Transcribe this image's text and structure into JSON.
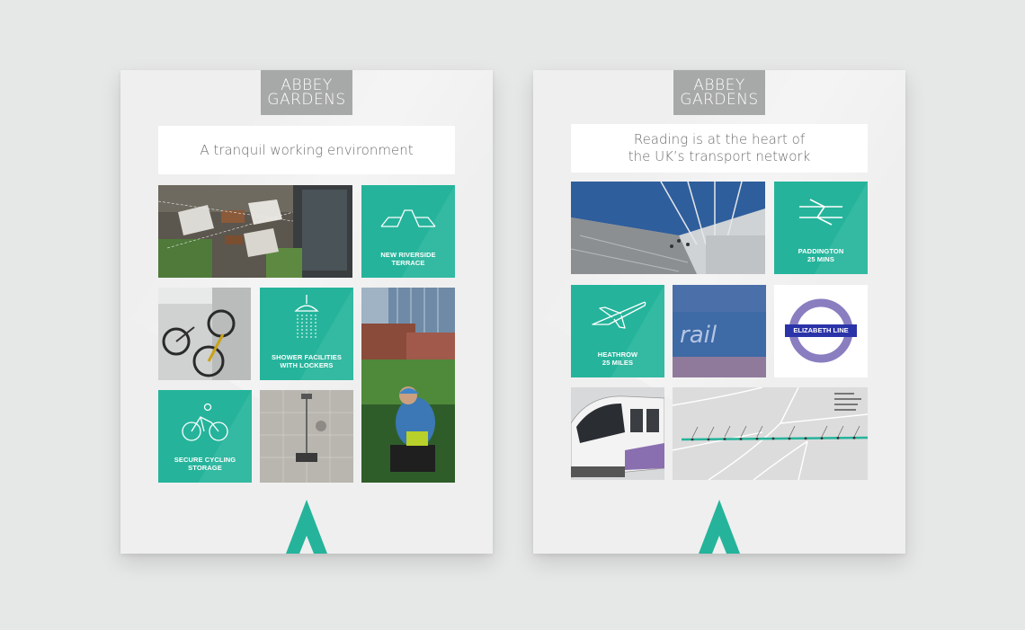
{
  "colors": {
    "background": "#e6e7e7",
    "sheet": "#efefef",
    "teal": "#25b49b",
    "logo_bg": "#a7a8a8",
    "elizabeth_purple": "#8a7ec1",
    "elizabeth_blue": "#2a33a8"
  },
  "sheet1": {
    "logo": {
      "line1": "ABBEY",
      "line2": "GARDENS"
    },
    "title": "A tranquil working environment",
    "tiles": [
      {
        "icon": "terrace-icon",
        "label": "NEW RIVERSIDE\nTERRACE"
      },
      {
        "icon": "shower-icon",
        "label": "SHOWER FACILITIES\nWITH LOCKERS"
      },
      {
        "icon": "cyclist-icon",
        "label": "SECURE CYCLING\nSTORAGE"
      }
    ]
  },
  "sheet2": {
    "logo": {
      "line1": "ABBEY",
      "line2": "GARDENS"
    },
    "title": "Reading is at the heart of\nthe UK’s transport network",
    "tiles": [
      {
        "icon": "national-rail-icon",
        "label": "PADDINGTON\n25 MINS"
      },
      {
        "icon": "airplane-icon",
        "label": "HEATHROW\n25 MILES"
      }
    ],
    "elizabeth_line": "ELIZABETH LINE",
    "photo_sign_text": "rail"
  }
}
